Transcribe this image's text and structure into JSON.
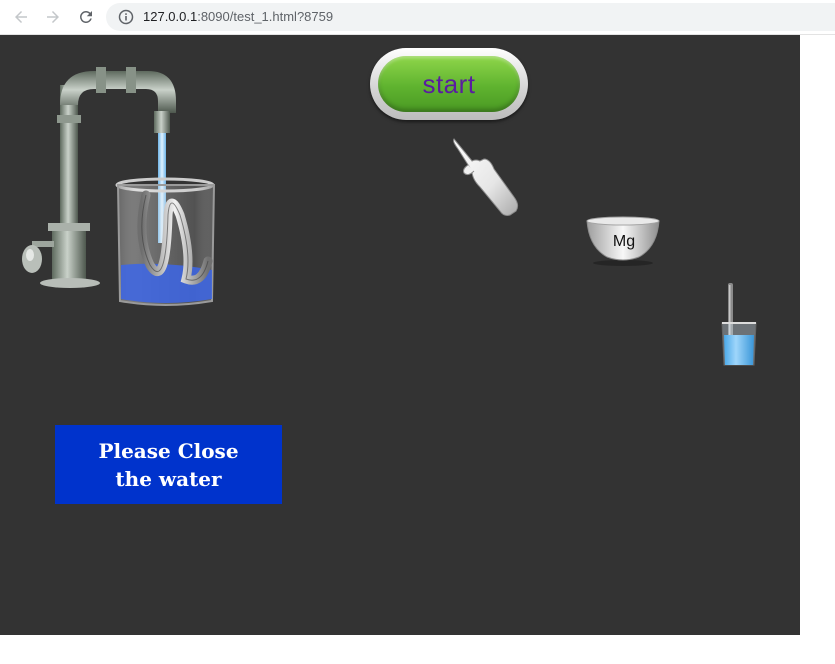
{
  "browser": {
    "url_host": "127.0.0.1",
    "url_rest": ":8090/test_1.html?8759"
  },
  "icons": {
    "back": "arrow-left-icon",
    "forward": "arrow-right-icon",
    "reload": "reload-icon",
    "info": "info-circle-icon"
  },
  "stage": {
    "start_label": "start",
    "bowl_label": "Mg",
    "notice_line1": "Please Close",
    "notice_line2": "the water"
  },
  "colors": {
    "stage_bg": "#333333",
    "notice_bg": "#0033cc",
    "start_green": "#5fb32f",
    "start_text": "#5a1da0"
  }
}
